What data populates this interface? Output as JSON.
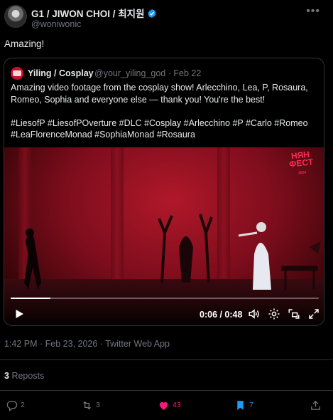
{
  "author": {
    "name": "G1 / JIWON CHOI / 최지원",
    "handle": "@woniwonic"
  },
  "tweet": {
    "text": "Amazing!"
  },
  "quote": {
    "name": "Yiling / Cosplay",
    "meta": "@your_yiling_god · Feb 22",
    "body": "Amazing video footage from the cosplay show! Arlecchino, Lea, P, Rosaura, Romeo, Sophia and everyone else — thank you! You're the best!\n\n#LiesofP #LiesofPOverture #DLC #Cosplay #Arlecchino #P #Carlo #Romeo #LeaFlorenceMonad #SophiaMonad #Rosaura",
    "video": {
      "logo_line1": "НЯН",
      "logo_line2": "ФЕСТ",
      "logo_small": "2024",
      "time": "0:06 / 0:48",
      "progress_fraction": 0.13
    }
  },
  "meta": {
    "timestamp": "1:42 PM · Feb 23, 2026 · Twitter Web App"
  },
  "stats": {
    "reposts_count": "3",
    "reposts_label": "Reposts"
  },
  "actions": {
    "reply_count": "2",
    "retweet_count": "3",
    "like_count": "43",
    "bookmark_count": "7"
  },
  "colors": {
    "background": "#000000",
    "text": "#e7e9ea",
    "muted": "#71767b",
    "like": "#f91880",
    "bookmark": "#1d9bf0",
    "verified": "#1d9bf0"
  }
}
